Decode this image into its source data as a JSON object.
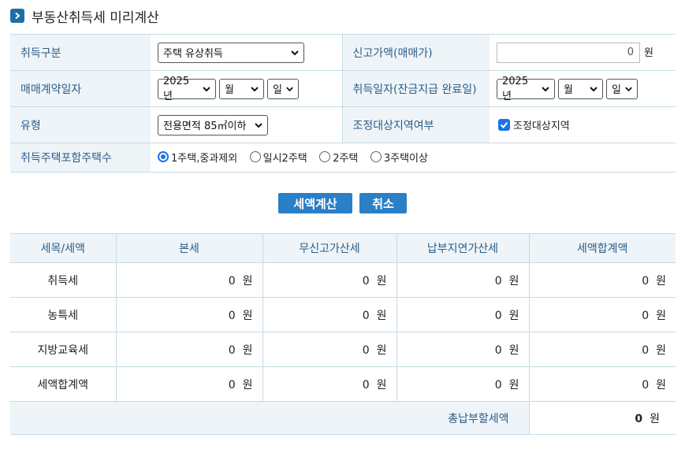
{
  "page": {
    "title": "부동산취득세 미리계산"
  },
  "form": {
    "acq_type_label": "취득구분",
    "acq_type_value": "주택 유상취득",
    "reported_price_label": "신고가액(매매가)",
    "reported_price_value": "0",
    "unit_won": "원",
    "contract_date_label": "매매계약일자",
    "contract_year": "2025년",
    "contract_month": "월",
    "contract_day": "일",
    "acq_date_label": "취득일자(잔금지급 완료일)",
    "acq_year": "2025년",
    "acq_month": "월",
    "acq_day": "일",
    "type_label": "유형",
    "type_value": "전용면적 85㎡이하",
    "regulated_label": "조정대상지역여부",
    "regulated_checkbox_label": "조정대상지역",
    "regulated_checked": true,
    "house_count_label": "취득주택포함주택수",
    "house_count_options": [
      "1주택,중과제외",
      "일시2주택",
      "2주택",
      "3주택이상"
    ],
    "house_count_selected": 0
  },
  "buttons": {
    "calc": "세액계산",
    "cancel": "취소"
  },
  "result": {
    "headers": [
      "세목/세액",
      "본세",
      "무신고가산세",
      "납부지연가산세",
      "세액합계액"
    ],
    "rows": [
      {
        "label": "취득세",
        "values": [
          "0",
          "0",
          "0",
          "0"
        ]
      },
      {
        "label": "농특세",
        "values": [
          "0",
          "0",
          "0",
          "0"
        ]
      },
      {
        "label": "지방교육세",
        "values": [
          "0",
          "0",
          "0",
          "0"
        ]
      },
      {
        "label": "세액합계액",
        "values": [
          "0",
          "0",
          "0",
          "0"
        ]
      }
    ],
    "total_label": "총납부할세액",
    "total_value": "0",
    "unit": "원"
  },
  "colors": {
    "accent": "#2a7fc6",
    "label_text": "#2b5d8a",
    "label_bg": "#eef4f7",
    "border": "#c6dbe5"
  }
}
